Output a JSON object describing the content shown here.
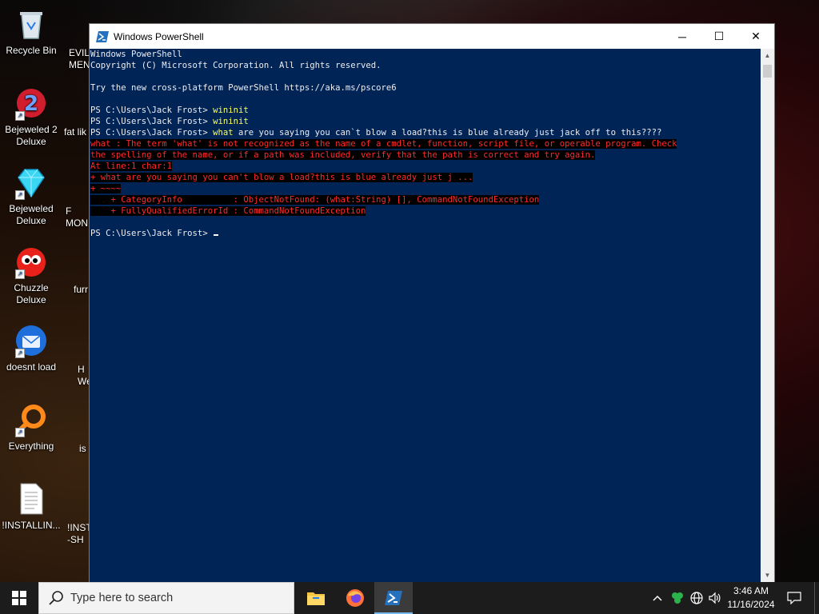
{
  "desktop": {
    "icons": [
      {
        "label": "Recycle Bin"
      },
      {
        "label": "Bejeweled 2 Deluxe"
      },
      {
        "label": "Bejeweled Deluxe"
      },
      {
        "label": "Chuzzle Deluxe"
      },
      {
        "label": "doesnt load"
      },
      {
        "label": "Everything"
      },
      {
        "label": "!INSTALLIN..."
      }
    ],
    "partial_icons": [
      {
        "label": "EVIL MEN"
      },
      {
        "label": "fat lik"
      },
      {
        "label": "F MON"
      },
      {
        "label": "furr"
      },
      {
        "label": "H We"
      },
      {
        "label": "is"
      },
      {
        "label": "!INST -SH"
      }
    ]
  },
  "window": {
    "title": "Windows PowerShell",
    "controls": {
      "minimize": "─",
      "maximize": "☐",
      "close": "✕"
    },
    "console_lines": [
      {
        "text": "Windows PowerShell",
        "style": "normal"
      },
      {
        "text": "Copyright (C) Microsoft Corporation. All rights reserved.",
        "style": "normal"
      },
      {
        "text": "",
        "style": "normal"
      },
      {
        "text": "Try the new cross-platform PowerShell https://aka.ms/pscore6",
        "style": "normal"
      },
      {
        "text": "",
        "style": "normal"
      },
      {
        "prompt": "PS C:\\Users\\Jack Frost> ",
        "cmd": "wininit",
        "rest": "",
        "style": "prompt"
      },
      {
        "prompt": "PS C:\\Users\\Jack Frost> ",
        "cmd": "wininit",
        "rest": "",
        "style": "prompt"
      },
      {
        "prompt": "PS C:\\Users\\Jack Frost> ",
        "cmd": "what",
        "rest": " are you saying you can`t blow a load?this is blue already just jack off to this????",
        "style": "prompt"
      },
      {
        "text": "what : The term 'what' is not recognized as the name of a cmdlet, function, script file, or operable program. Check",
        "style": "error"
      },
      {
        "text": "the spelling of the name, or if a path was included, verify that the path is correct and try again.",
        "style": "error"
      },
      {
        "text": "At line:1 char:1",
        "style": "error"
      },
      {
        "text": "+ what are you saying you can't blow a load?this is blue already just j ...",
        "style": "error"
      },
      {
        "text": "+ ~~~~",
        "style": "error"
      },
      {
        "text": "    + CategoryInfo          : ObjectNotFound: (what:String) [], CommandNotFoundException",
        "style": "error"
      },
      {
        "text": "    + FullyQualifiedErrorId : CommandNotFoundException",
        "style": "error"
      },
      {
        "text": "",
        "style": "normal"
      },
      {
        "prompt": "PS C:\\Users\\Jack Frost> ",
        "cmd": "",
        "rest": "",
        "style": "cursor"
      }
    ]
  },
  "taskbar": {
    "search_placeholder": "Type here to search",
    "apps": [
      {
        "name": "file-explorer"
      },
      {
        "name": "firefox"
      },
      {
        "name": "powershell",
        "active": true
      }
    ],
    "clock": {
      "time": "3:46 AM",
      "date": "11/16/2024"
    }
  },
  "colors": {
    "console_bg": "#012456",
    "console_fg": "#eeedf0",
    "command": "#ffff54",
    "error_fg": "#ff2a2a",
    "error_bg": "#000000",
    "taskbar_bg": "#1c1c1c"
  }
}
